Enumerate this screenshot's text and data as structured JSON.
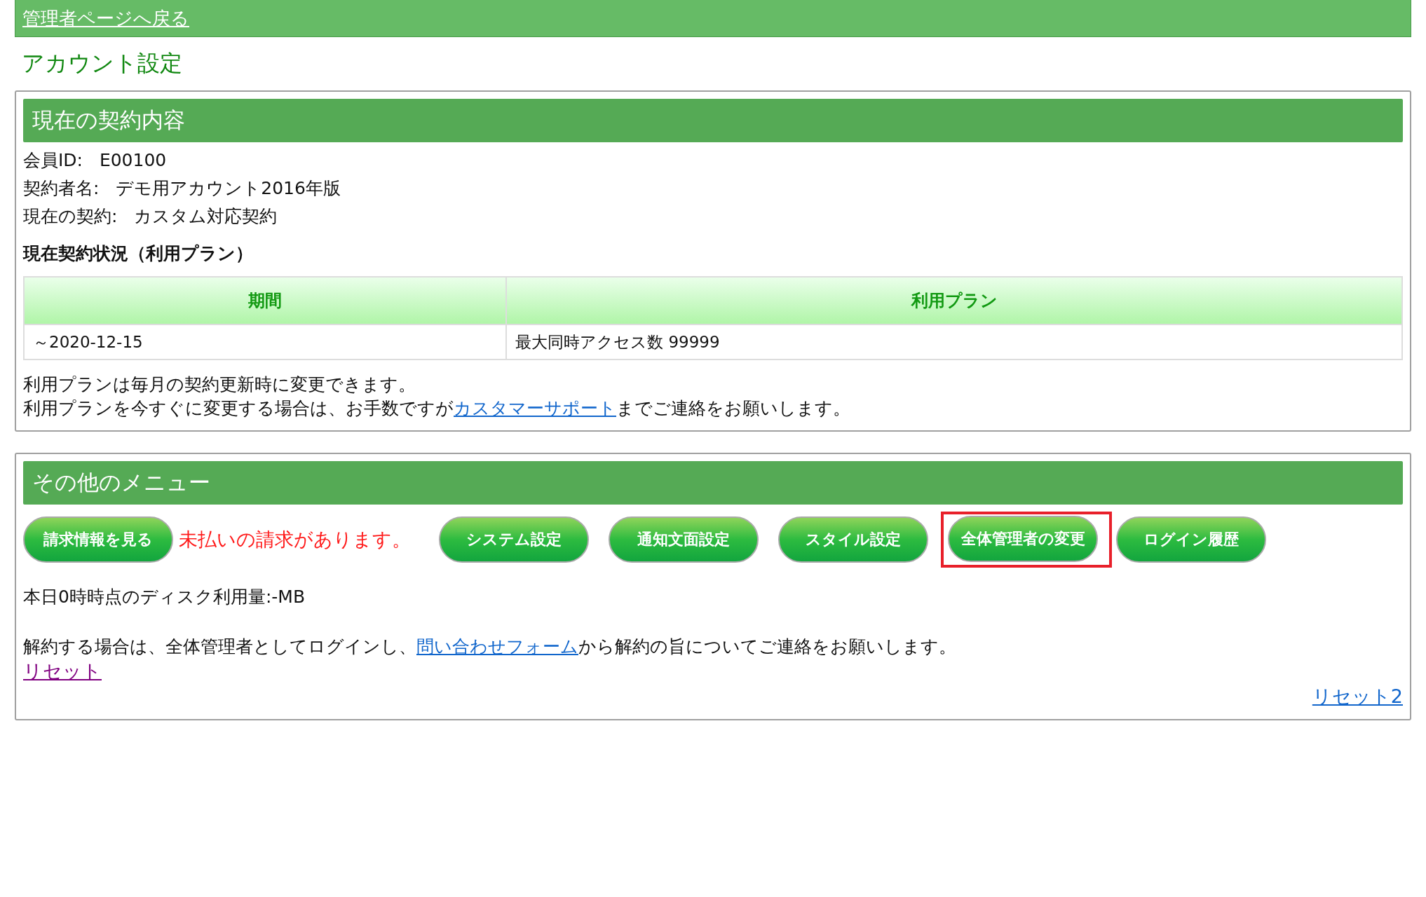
{
  "top_bar": {
    "back_link": "管理者ページへ戻る"
  },
  "page_title": "アカウント設定",
  "contract_panel": {
    "title": "現在の契約内容",
    "fields": [
      {
        "label": "会員ID:",
        "value": "E00100"
      },
      {
        "label": "契約者名:",
        "value": "デモ用アカウント2016年版"
      },
      {
        "label": "現在の契約:",
        "value": "カスタム対応契約"
      }
    ],
    "status_heading": "現在契約状況（利用プラン）",
    "table": {
      "columns": [
        "期間",
        "利用プラン"
      ],
      "rows": [
        [
          "～2020-12-15",
          "最大同時アクセス数 99999"
        ]
      ]
    },
    "note_line_1": "利用プランは毎月の契約更新時に変更できます。",
    "note_line_2": {
      "before": "利用プランを今すぐに変更する場合は、お手数ですが",
      "link": "カスタマーサポート",
      "after": "までご連絡をお願いします。"
    }
  },
  "menu_panel": {
    "title": "その他のメニュー",
    "buttons": [
      {
        "kind": "button",
        "label": "請求情報を見る",
        "highlighted": false
      },
      {
        "kind": "warning",
        "label": "未払いの請求があります。"
      },
      {
        "kind": "button",
        "label": "システム設定",
        "highlighted": false
      },
      {
        "kind": "button",
        "label": "通知文面設定",
        "highlighted": false
      },
      {
        "kind": "button",
        "label": "スタイル設定",
        "highlighted": false
      },
      {
        "kind": "button",
        "label": "全体管理者の変更",
        "highlighted": true
      },
      {
        "kind": "button",
        "label": "ログイン履歴",
        "highlighted": false
      }
    ],
    "disk_usage": "本日0時時点のディスク利用量:-MB",
    "cancel_note": {
      "before": "解約する場合は、全体管理者としてログインし、",
      "link": "問い合わせフォーム",
      "after": "から解約の旨についてご連絡をお願いします。"
    },
    "reset_links": [
      {
        "label": "リセット",
        "visited": true
      },
      {
        "label": "リセット2",
        "visited": false
      }
    ]
  }
}
